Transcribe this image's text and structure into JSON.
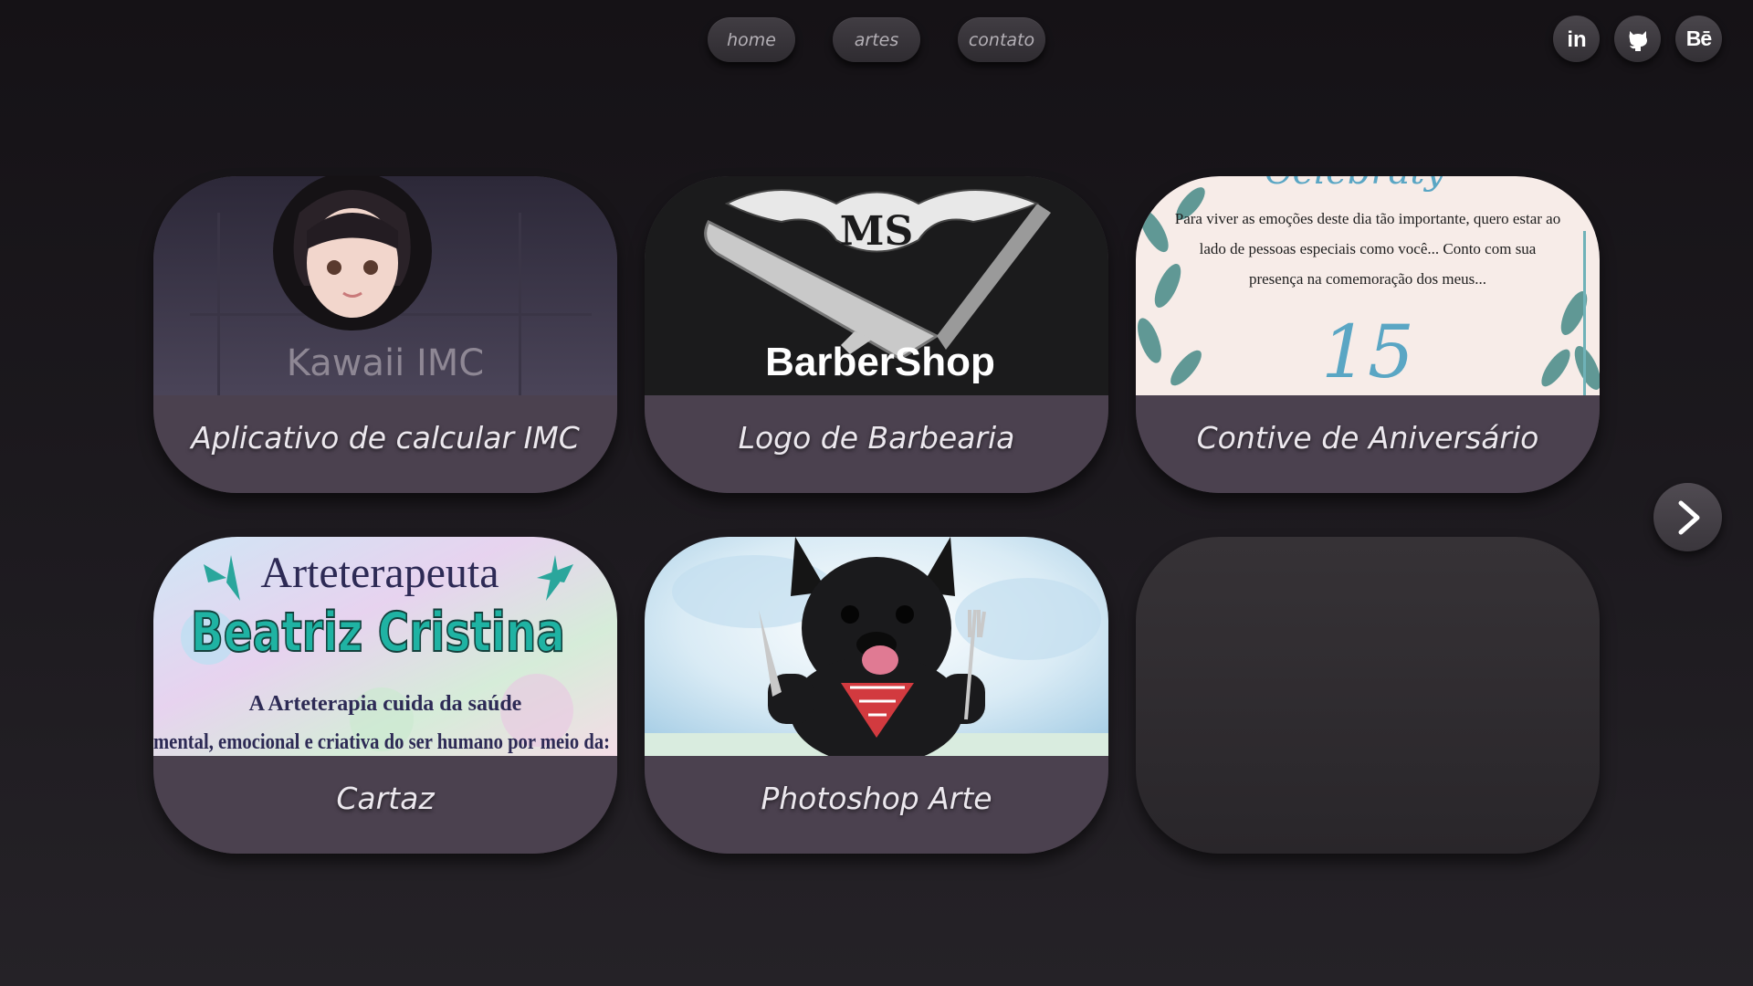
{
  "nav": {
    "items": [
      {
        "label": "home"
      },
      {
        "label": "artes"
      },
      {
        "label": "contato"
      }
    ]
  },
  "social": {
    "icons": [
      "linkedin-icon",
      "github-icon",
      "behance-icon"
    ],
    "linkedin_glyph": "in",
    "behance_glyph": "Bē"
  },
  "cards": [
    {
      "caption": "Aplicativo de calcular IMC",
      "image_text": "Kawaii IMC"
    },
    {
      "caption": "Logo de Barbearia",
      "image_text": "BarberShop"
    },
    {
      "caption": "Contive de Aniversário",
      "image_text": [
        "Para viver as emoções deste dia tão importante, quero estar ao",
        "lado de pessoas especiais como você... Conto com sua",
        "presença na comemoração dos meus...",
        "15"
      ]
    },
    {
      "caption": "Cartaz",
      "image_text": [
        "Arteterapeuta",
        "Beatriz Cristina",
        "A Arteterapia cuida da saúde",
        "mental, emocional e criativa do ser humano por meio da:"
      ]
    },
    {
      "caption": "Photoshop Arte"
    },
    {
      "caption": ""
    }
  ],
  "colors": {
    "background": "#1b181c",
    "card": "#4b414f",
    "pill": "#3a363c",
    "caption_text": "#ece8ee"
  },
  "next_button_icon": "chevron-right-icon"
}
